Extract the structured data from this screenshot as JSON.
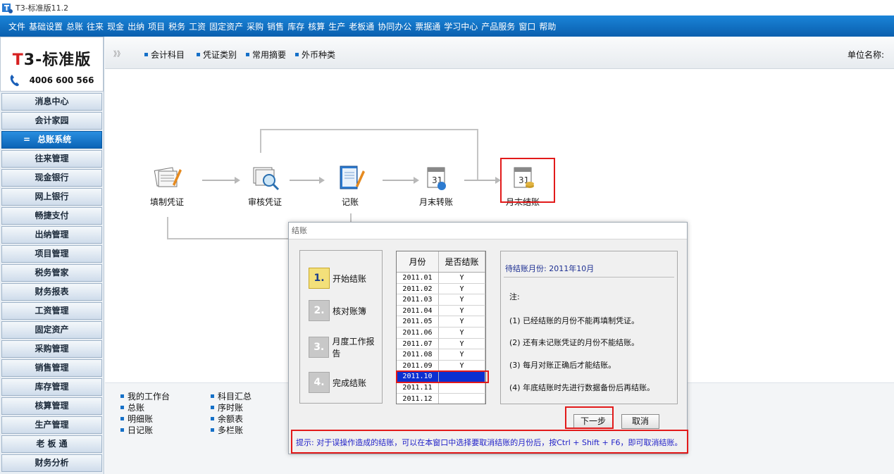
{
  "window": {
    "title": "T3-标准版11.2"
  },
  "menu": [
    "文件",
    "基础设置",
    "总账",
    "往来",
    "现金",
    "出纳",
    "项目",
    "税务",
    "工资",
    "固定资产",
    "采购",
    "销售",
    "库存",
    "核算",
    "生产",
    "老板通",
    "协同办公",
    "票据通",
    "学习中心",
    "产品服务",
    "窗口",
    "帮助"
  ],
  "logo": {
    "t": "T",
    "rest": "3-标准版",
    "phone": "4006 600 566"
  },
  "sidebar": {
    "items": [
      "消息中心",
      "会计家园",
      "总账系统",
      "往来管理",
      "现金银行",
      "网上银行",
      "畅捷支付",
      "出纳管理",
      "项目管理",
      "税务管家",
      "财务报表",
      "工资管理",
      "固定资产",
      "采购管理",
      "销售管理",
      "库存管理",
      "核算管理",
      "生产管理",
      "老 板 通",
      "财务分析"
    ],
    "active_dash": "="
  },
  "toolbar": {
    "chevron": "》》",
    "links": [
      "会计科目",
      "凭证类别",
      "常用摘要",
      "外币种类"
    ],
    "unit_label": "单位名称:"
  },
  "flow": {
    "steps": [
      "填制凭证",
      "审核凭证",
      "记账",
      "月末转账",
      "月末结账"
    ]
  },
  "bottom_links": {
    "col1": [
      "我的工作台",
      "总账",
      "明细账",
      "日记账"
    ],
    "col2": [
      "科目汇总",
      "序时账",
      "余额表",
      "多栏账"
    ]
  },
  "dialog": {
    "title": "结账",
    "steps": [
      {
        "num": "1.",
        "label": "开始结账"
      },
      {
        "num": "2.",
        "label": "核对账簿"
      },
      {
        "num": "3.",
        "label": "月度工作报告"
      },
      {
        "num": "4.",
        "label": "完成结账"
      }
    ],
    "table": {
      "headers": [
        "月份",
        "是否结账"
      ],
      "rows": [
        [
          "2011.01",
          "Y"
        ],
        [
          "2011.02",
          "Y"
        ],
        [
          "2011.03",
          "Y"
        ],
        [
          "2011.04",
          "Y"
        ],
        [
          "2011.05",
          "Y"
        ],
        [
          "2011.06",
          "Y"
        ],
        [
          "2011.07",
          "Y"
        ],
        [
          "2011.08",
          "Y"
        ],
        [
          "2011.09",
          "Y"
        ],
        [
          "2011.10",
          ""
        ],
        [
          "2011.11",
          ""
        ],
        [
          "2011.12",
          ""
        ]
      ],
      "selected_index": 9
    },
    "info": {
      "pending": "待结账月份: 2011年10月",
      "note_title": "注:",
      "notes": [
        "(1) 已经结账的月份不能再填制凭证。",
        "(2) 还有未记账凭证的月份不能结账。",
        "(3) 每月对账正确后才能结账。",
        "(4) 年底结账时先进行数据备份后再结账。"
      ]
    },
    "next_button": "下一步",
    "cancel_button": "取消",
    "hint": "提示: 对于误操作造成的结账，可以在本窗口中选择要取消结账的月份后，按Ctrl + Shift + F6，即可取消结账。"
  },
  "colors": {
    "menu_blue": "#0a5fae",
    "highlight_red": "#e21a1a",
    "selected_row": "#0b2fd1"
  }
}
